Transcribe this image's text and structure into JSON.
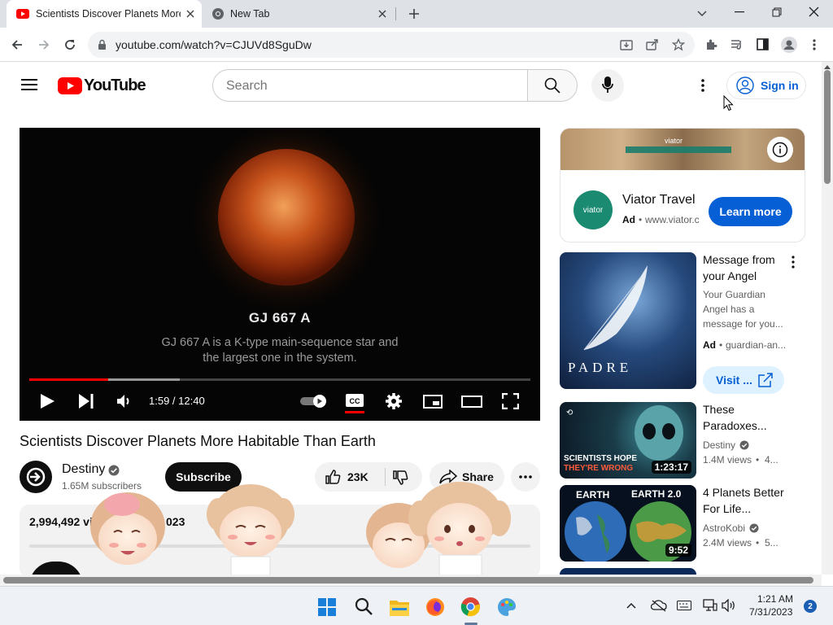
{
  "browser": {
    "tabs": [
      {
        "title": "Scientists Discover Planets More",
        "active": true
      },
      {
        "title": "New Tab",
        "active": false
      }
    ],
    "url": "youtube.com/watch?v=CJUVd8SguDw"
  },
  "youtube": {
    "logo_text": "YouTube",
    "search_placeholder": "Search",
    "sign_in": "Sign in"
  },
  "player": {
    "caption_title": "GJ 667 A",
    "caption_line1": "GJ 667 A is a K-type main-sequence star and",
    "caption_line2": "the largest one in the system.",
    "time": "1:59 / 12:40",
    "progress_fraction": 0.157,
    "buffer_fraction": 0.3
  },
  "video": {
    "title": "Scientists Discover Planets More Habitable Than Earth",
    "channel": "Destiny",
    "subscribers": "1.65M subscribers",
    "subscribe_label": "Subscribe",
    "likes": "23K",
    "share_label": "Share",
    "views_date": "2,994,492 vi",
    "date_tail": "023"
  },
  "sidebar": {
    "ad": {
      "banner_text": "viator",
      "name": "Viator Travel",
      "badge": "Ad",
      "domain": "www.viator.c",
      "logo_text": "viator",
      "cta": "Learn more"
    },
    "promo": {
      "title": "Message from your Angel",
      "desc": "Your Guardian Angel has a message for you...",
      "badge": "Ad",
      "domain": "guardian-an...",
      "thumb_text": "PADRE",
      "cta": "Visit ..."
    },
    "videos": [
      {
        "title": "These Paradoxes...",
        "channel": "Destiny",
        "views": "1.4M views",
        "age": "4...",
        "duration": "1:23:17",
        "thumb_caption1": "SCIENTISTS HOPE",
        "thumb_caption2": "THEY'RE WRONG"
      },
      {
        "title": "4 Planets Better For Life...",
        "channel": "AstroKobi",
        "views": "2.4M views",
        "age": "5...",
        "duration": "9:52",
        "thumb_left": "EARTH",
        "thumb_right": "EARTH 2.0"
      }
    ]
  },
  "taskbar": {
    "time": "1:21 AM",
    "date": "7/31/2023",
    "notifications": "2"
  }
}
